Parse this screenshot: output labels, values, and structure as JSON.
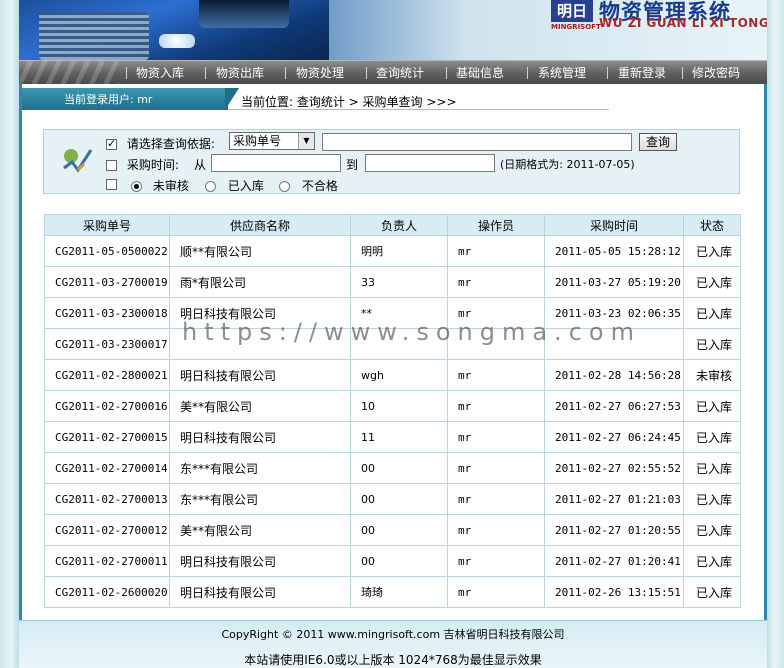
{
  "header": {
    "logo_text": "明日",
    "logo_sub": "MINGRISOFT",
    "title": "物资管理系统",
    "title_en": "WU ZI GUAN LI XI TONG"
  },
  "menu": [
    {
      "label": "物资入库"
    },
    {
      "label": "物资出库"
    },
    {
      "label": "物资处理"
    },
    {
      "label": "查询统计"
    },
    {
      "label": "基础信息"
    },
    {
      "label": "系统管理"
    },
    {
      "label": "重新登录"
    },
    {
      "label": "修改密码"
    }
  ],
  "infobar": {
    "user": "当前登录用户: mr",
    "breadcrumb": "当前位置: 查询统计 > 采购单查询 >>>"
  },
  "query": {
    "row1_label": "请选择查询依据:",
    "row1_checked": true,
    "select_value": "采购单号",
    "search_value": "",
    "search_button": "查询",
    "row2_label": "采购时间:",
    "from_label": "从",
    "to_label": "到",
    "from_value": "",
    "to_value": "",
    "date_hint": "(日期格式为: 2011-07-05)",
    "radio_unchecked": "未审核",
    "radio_stocked": "已入库",
    "radio_rejected": "不合格"
  },
  "table": {
    "headers": [
      "采购单号",
      "供应商名称",
      "负责人",
      "操作员",
      "采购时间",
      "状态"
    ],
    "rows": [
      [
        "CG2011-05-0500022",
        "顺**有限公司",
        "明明",
        "mr",
        "2011-05-05 15:28:12",
        "已入库"
      ],
      [
        "CG2011-03-2700019",
        "雨*有限公司",
        "33",
        "mr",
        "2011-03-27 05:19:20",
        "已入库"
      ],
      [
        "CG2011-03-2300018",
        "明日科技有限公司",
        "**",
        "mr",
        "2011-03-23 02:06:35",
        "已入库"
      ],
      [
        "CG2011-03-2300017",
        "",
        "",
        "",
        "",
        "已入库"
      ],
      [
        "CG2011-02-2800021",
        "明日科技有限公司",
        "wgh",
        "mr",
        "2011-02-28 14:56:28",
        "未审核"
      ],
      [
        "CG2011-02-2700016",
        "美**有限公司",
        "10",
        "mr",
        "2011-02-27 06:27:53",
        "已入库"
      ],
      [
        "CG2011-02-2700015",
        "明日科技有限公司",
        "11",
        "mr",
        "2011-02-27 06:24:45",
        "已入库"
      ],
      [
        "CG2011-02-2700014",
        "东***有限公司",
        "00",
        "mr",
        "2011-02-27 02:55:52",
        "已入库"
      ],
      [
        "CG2011-02-2700013",
        "东***有限公司",
        "00",
        "mr",
        "2011-02-27 01:21:03",
        "已入库"
      ],
      [
        "CG2011-02-2700012",
        "美**有限公司",
        "00",
        "mr",
        "2011-02-27 01:20:55",
        "已入库"
      ],
      [
        "CG2011-02-2700011",
        "明日科技有限公司",
        "00",
        "mr",
        "2011-02-27 01:20:41",
        "已入库"
      ],
      [
        "CG2011-02-2600020",
        "明日科技有限公司",
        "琦琦",
        "mr",
        "2011-02-26 13:15:51",
        "已入库"
      ]
    ]
  },
  "watermark": "https://www.songma.com",
  "footer": {
    "line1": "CopyRight © 2011 www.mingrisoft.com 吉林省明日科技有限公司",
    "line2": "本站请使用IE6.0或以上版本 1024*768为最佳显示效果"
  },
  "colors": {
    "accent": "#2e8aa6",
    "menu_bg": "#5f5f5f",
    "header_bg": "#d8ecf3"
  }
}
